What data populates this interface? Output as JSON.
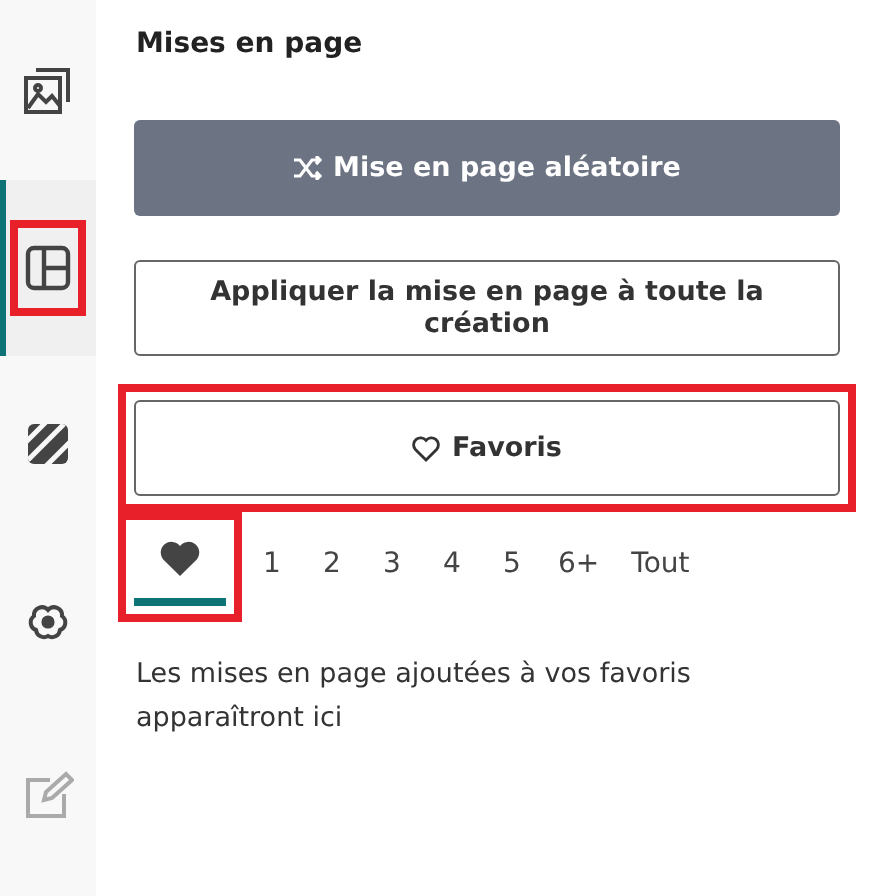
{
  "sidebar": {
    "items": [
      {
        "kind": "image",
        "selected": false,
        "disabled": false,
        "highlighted": false
      },
      {
        "kind": "layout",
        "selected": true,
        "disabled": false,
        "highlighted": true
      },
      {
        "kind": "pattern",
        "selected": false,
        "disabled": false,
        "highlighted": false
      },
      {
        "kind": "flower",
        "selected": false,
        "disabled": false,
        "highlighted": false
      },
      {
        "kind": "edit",
        "selected": false,
        "disabled": true,
        "highlighted": false
      }
    ]
  },
  "panel": {
    "title": "Mises en page",
    "buttons": [
      {
        "kind": "shuffle",
        "label": "Mise en page aléatoire",
        "highlighted": false
      },
      {
        "kind": "apply",
        "label": "Appliquer la mise en page à toute la création",
        "highlighted": false
      },
      {
        "kind": "favorites",
        "label": "Favoris",
        "highlighted": true
      }
    ],
    "tabs": [
      {
        "kind": "heart",
        "selected": true,
        "highlighted": true
      },
      {
        "label": "1",
        "selected": false,
        "highlighted": false
      },
      {
        "label": "2",
        "selected": false,
        "highlighted": false
      },
      {
        "label": "3",
        "selected": false,
        "highlighted": false
      },
      {
        "label": "4",
        "selected": false,
        "highlighted": false
      },
      {
        "label": "5",
        "selected": false,
        "highlighted": false
      },
      {
        "label": "6+",
        "selected": false,
        "highlighted": false
      },
      {
        "label": "Tout",
        "selected": false,
        "highlighted": false
      }
    ],
    "message": "Les mises en page ajoutées à vos favoris apparaîtront ici"
  }
}
